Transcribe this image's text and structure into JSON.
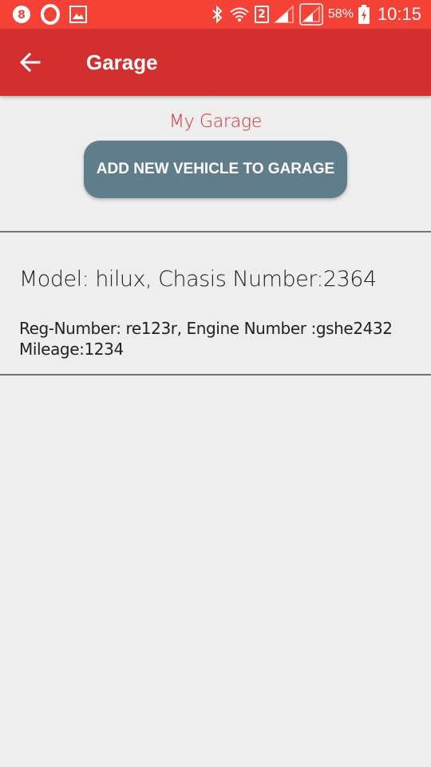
{
  "status_bar": {
    "sim_slot": "2",
    "battery_percent": "58%",
    "time": "10:15",
    "icons": [
      "notification-app-icon",
      "opera-icon",
      "gallery-icon",
      "bluetooth-icon",
      "wifi-icon",
      "sim-2-icon",
      "signal-icon",
      "signal-icon",
      "battery-charging-icon"
    ]
  },
  "app_bar": {
    "title": "Garage",
    "back_icon": "arrow-back-icon"
  },
  "main": {
    "section_title": "My Garage",
    "add_button_label": "ADD NEW VEHICLE TO GARAGE",
    "vehicles": [
      {
        "title": "Model: hilux, Chasis Number:2364",
        "details_line1": "Reg-Number: re123r, Engine Number :gshe2432",
        "details_line2": "Mileage:1234"
      }
    ]
  },
  "colors": {
    "status_bar": "#f44336",
    "app_bar": "#d32f2f",
    "accent_text": "#d32f2f",
    "button": "#607d8b",
    "background": "#eeeeee"
  }
}
